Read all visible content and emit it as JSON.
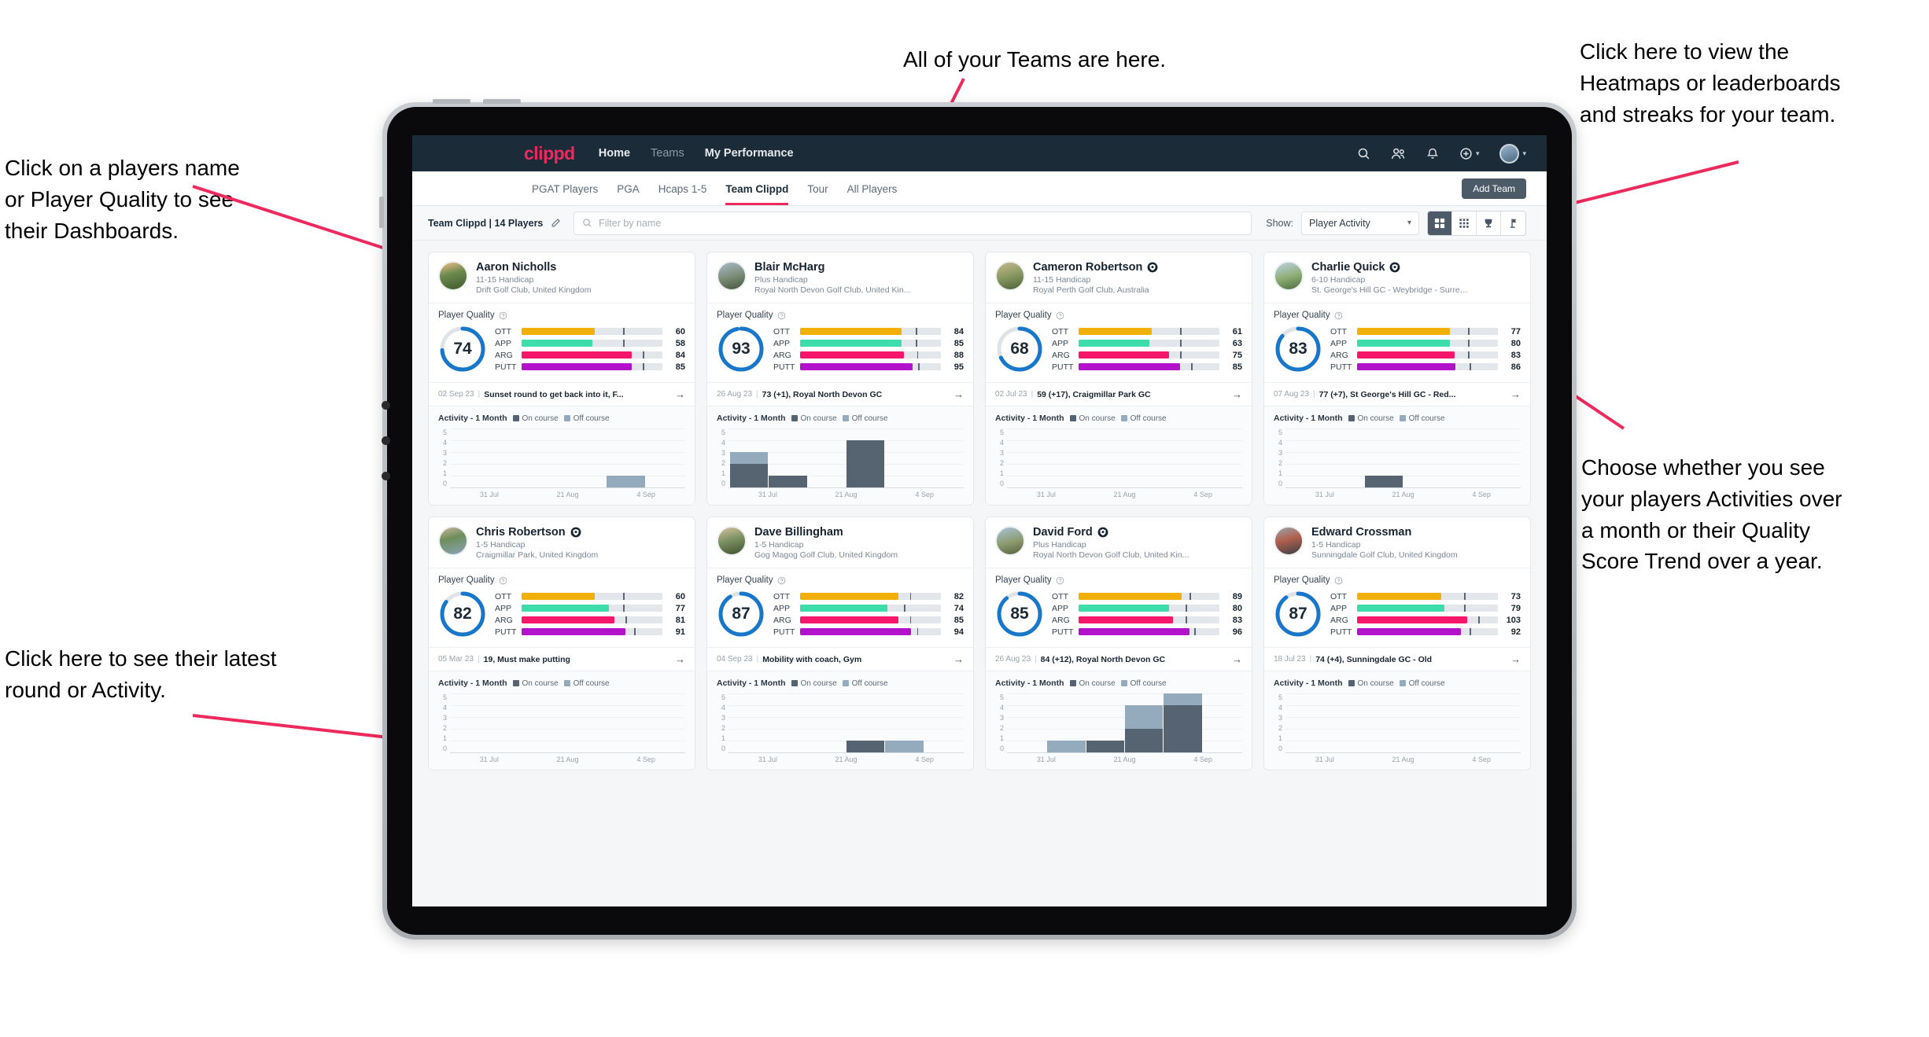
{
  "annotations": [
    {
      "id": "teams-note",
      "text": "All of your Teams are here."
    },
    {
      "id": "heatmaps-note",
      "text": "Click here to view the\nHeatmaps or leaderboards\nand streaks for your team."
    },
    {
      "id": "playername-note",
      "text": "Click on a players name\nor Player Quality to see\ntheir Dashboards."
    },
    {
      "id": "activity-note",
      "text": "Choose whether you see\nyour players Activities over\na month or their Quality\nScore Trend over a year."
    },
    {
      "id": "latest-note",
      "text": "Click here to see their latest\nround or Activity."
    }
  ],
  "topnav": {
    "logo": "clippd",
    "links": [
      {
        "label": "Home",
        "active": true
      },
      {
        "label": "Teams",
        "active": false
      },
      {
        "label": "My Performance",
        "active": true
      }
    ],
    "icons": [
      "search-icon",
      "people-icon",
      "bell-icon",
      "plus-circle-icon",
      "avatar"
    ]
  },
  "subnav": {
    "tabs": [
      {
        "label": "PGAT Players",
        "active": false
      },
      {
        "label": "PGA",
        "active": false
      },
      {
        "label": "Hcaps 1-5",
        "active": false
      },
      {
        "label": "Team Clippd",
        "active": true
      },
      {
        "label": "Tour",
        "active": false
      },
      {
        "label": "All Players",
        "active": false
      }
    ],
    "add_team_label": "Add Team"
  },
  "toolbar": {
    "team_label": "Team Clippd | 14 Players",
    "edit_icon": "pencil-icon",
    "search_placeholder": "Filter by name",
    "search_value": "",
    "show_label": "Show:",
    "show_selected": "Player Activity",
    "view_buttons": [
      {
        "name": "grid-view",
        "icon": "grid-icon",
        "active": true
      },
      {
        "name": "compact-view",
        "icon": "dots-grid-icon",
        "active": false
      },
      {
        "name": "leaderboard-view",
        "icon": "trophy-icon",
        "active": false
      },
      {
        "name": "streaks-view",
        "icon": "flag-icon",
        "active": false
      }
    ]
  },
  "card_labels": {
    "quality_title": "Player Quality",
    "activity_title": "Activity - 1 Month",
    "legend_on": "On course",
    "legend_off": "Off course",
    "metrics": [
      "OTT",
      "APP",
      "ARG",
      "PUTT"
    ],
    "x_ticks": [
      "31 Jul",
      "21 Aug",
      "4 Sep"
    ],
    "y_ticks": [
      "5",
      "4",
      "3",
      "2",
      "1",
      "0"
    ]
  },
  "colors": {
    "accent": "#ec2a5e",
    "navbar": "#1b2b38",
    "ring": "#1877c9",
    "ott": "#f2b007",
    "app": "#3ddcab",
    "arg": "#f4176a",
    "putt": "#b312cb",
    "on_course": "#566471",
    "off_course": "#94aabd"
  },
  "chart_data": {
    "type": "bar",
    "title": "Activity - 1 Month",
    "categories": [
      "31 Jul",
      "21 Aug",
      "4 Sep"
    ],
    "ylim": [
      0,
      5
    ],
    "ylabel": "",
    "xlabel": "",
    "grid": true,
    "legend": [
      "On course",
      "Off course"
    ],
    "stacked": true
  },
  "players": [
    {
      "name": "Aaron Nicholls",
      "verified": false,
      "avatar": "av1",
      "handicap": "11-15 Handicap",
      "club": "Drift Golf Club, United Kingdom",
      "quality": 74,
      "ring_pct": 74,
      "metrics": [
        {
          "label": "OTT",
          "value": 60,
          "fill": 52,
          "tick": 72
        },
        {
          "label": "APP",
          "value": 58,
          "fill": 50,
          "tick": 72
        },
        {
          "label": "ARG",
          "value": 84,
          "fill": 78,
          "tick": 86
        },
        {
          "label": "PUTT",
          "value": 85,
          "fill": 78,
          "tick": 86
        }
      ],
      "round_date": "02 Sep 23",
      "round_text": "Sunset round to get back into it, F...",
      "activity": [
        {
          "on": 0,
          "off": 0
        },
        {
          "on": 0,
          "off": 0
        },
        {
          "on": 0,
          "off": 0
        },
        {
          "on": 0,
          "off": 0
        },
        {
          "on": 0,
          "off": 1
        },
        {
          "on": 0,
          "off": 0
        }
      ]
    },
    {
      "name": "Blair McHarg",
      "verified": false,
      "avatar": "av2",
      "handicap": "Plus Handicap",
      "club": "Royal North Devon Golf Club, United Kin...",
      "quality": 93,
      "ring_pct": 97,
      "metrics": [
        {
          "label": "OTT",
          "value": 84,
          "fill": 72,
          "tick": 82
        },
        {
          "label": "APP",
          "value": 85,
          "fill": 72,
          "tick": 82
        },
        {
          "label": "ARG",
          "value": 88,
          "fill": 74,
          "tick": 83
        },
        {
          "label": "PUTT",
          "value": 95,
          "fill": 80,
          "tick": 84
        }
      ],
      "round_date": "26 Aug 23",
      "round_text": "73 (+1), Royal North Devon GC",
      "activity": [
        {
          "on": 2,
          "off": 1
        },
        {
          "on": 1,
          "off": 0
        },
        {
          "on": 0,
          "off": 0
        },
        {
          "on": 4,
          "off": 0
        },
        {
          "on": 0,
          "off": 0
        },
        {
          "on": 0,
          "off": 0
        }
      ]
    },
    {
      "name": "Cameron Robertson",
      "verified": true,
      "avatar": "av3",
      "handicap": "11-15 Handicap",
      "club": "Royal Perth Golf Club, Australia",
      "quality": 68,
      "ring_pct": 68,
      "metrics": [
        {
          "label": "OTT",
          "value": 61,
          "fill": 52,
          "tick": 72
        },
        {
          "label": "APP",
          "value": 63,
          "fill": 50,
          "tick": 72
        },
        {
          "label": "ARG",
          "value": 75,
          "fill": 64,
          "tick": 72
        },
        {
          "label": "PUTT",
          "value": 85,
          "fill": 72,
          "tick": 80
        }
      ],
      "round_date": "02 Jul 23",
      "round_text": "59 (+17), Craigmillar Park GC",
      "activity": [
        {
          "on": 0,
          "off": 0
        },
        {
          "on": 0,
          "off": 0
        },
        {
          "on": 0,
          "off": 0
        },
        {
          "on": 0,
          "off": 0
        },
        {
          "on": 0,
          "off": 0
        },
        {
          "on": 0,
          "off": 0
        }
      ]
    },
    {
      "name": "Charlie Quick",
      "verified": true,
      "avatar": "av4",
      "handicap": "6-10 Handicap",
      "club": "St. George's Hill GC - Weybridge - Surrey, ...",
      "quality": 83,
      "ring_pct": 86,
      "metrics": [
        {
          "label": "OTT",
          "value": 77,
          "fill": 66,
          "tick": 79
        },
        {
          "label": "APP",
          "value": 80,
          "fill": 66,
          "tick": 79
        },
        {
          "label": "ARG",
          "value": 83,
          "fill": 69,
          "tick": 79
        },
        {
          "label": "PUTT",
          "value": 86,
          "fill": 70,
          "tick": 80
        }
      ],
      "round_date": "07 Aug 23",
      "round_text": "77 (+7), St George's Hill GC - Red...",
      "activity": [
        {
          "on": 0,
          "off": 0
        },
        {
          "on": 0,
          "off": 0
        },
        {
          "on": 1,
          "off": 0
        },
        {
          "on": 0,
          "off": 0
        },
        {
          "on": 0,
          "off": 0
        },
        {
          "on": 0,
          "off": 0
        }
      ]
    },
    {
      "name": "Chris Robertson",
      "verified": true,
      "avatar": "av5",
      "handicap": "1-5 Handicap",
      "club": "Craigmillar Park, United Kingdom",
      "quality": 82,
      "ring_pct": 85,
      "metrics": [
        {
          "label": "OTT",
          "value": 60,
          "fill": 52,
          "tick": 72
        },
        {
          "label": "APP",
          "value": 77,
          "fill": 62,
          "tick": 72
        },
        {
          "label": "ARG",
          "value": 81,
          "fill": 66,
          "tick": 74
        },
        {
          "label": "PUTT",
          "value": 91,
          "fill": 74,
          "tick": 80
        }
      ],
      "round_date": "05 Mar 23",
      "round_text": "19, Must make putting",
      "activity": [
        {
          "on": 0,
          "off": 0
        },
        {
          "on": 0,
          "off": 0
        },
        {
          "on": 0,
          "off": 0
        },
        {
          "on": 0,
          "off": 0
        },
        {
          "on": 0,
          "off": 0
        },
        {
          "on": 0,
          "off": 0
        }
      ]
    },
    {
      "name": "Dave Billingham",
      "verified": false,
      "avatar": "av6",
      "handicap": "1-5 Handicap",
      "club": "Gog Magog Golf Club, United Kingdom",
      "quality": 87,
      "ring_pct": 91,
      "metrics": [
        {
          "label": "OTT",
          "value": 82,
          "fill": 70,
          "tick": 78
        },
        {
          "label": "APP",
          "value": 74,
          "fill": 62,
          "tick": 74
        },
        {
          "label": "ARG",
          "value": 85,
          "fill": 70,
          "tick": 78
        },
        {
          "label": "PUTT",
          "value": 94,
          "fill": 79,
          "tick": 83
        }
      ],
      "round_date": "04 Sep 23",
      "round_text": "Mobility with coach, Gym",
      "activity": [
        {
          "on": 0,
          "off": 0
        },
        {
          "on": 0,
          "off": 0
        },
        {
          "on": 0,
          "off": 0
        },
        {
          "on": 1,
          "off": 0
        },
        {
          "on": 0,
          "off": 1
        },
        {
          "on": 0,
          "off": 0
        }
      ]
    },
    {
      "name": "David Ford",
      "verified": true,
      "avatar": "av7",
      "handicap": "Plus Handicap",
      "club": "Royal North Devon Golf Club, United Kin...",
      "quality": 85,
      "ring_pct": 89,
      "metrics": [
        {
          "label": "OTT",
          "value": 89,
          "fill": 73,
          "tick": 79
        },
        {
          "label": "APP",
          "value": 80,
          "fill": 64,
          "tick": 76
        },
        {
          "label": "ARG",
          "value": 83,
          "fill": 67,
          "tick": 76
        },
        {
          "label": "PUTT",
          "value": 96,
          "fill": 79,
          "tick": 82
        }
      ],
      "round_date": "26 Aug 23",
      "round_text": "84 (+12), Royal North Devon GC",
      "activity": [
        {
          "on": 0,
          "off": 0
        },
        {
          "on": 0,
          "off": 1
        },
        {
          "on": 1,
          "off": 0
        },
        {
          "on": 2,
          "off": 2
        },
        {
          "on": 4,
          "off": 1
        },
        {
          "on": 0,
          "off": 0
        }
      ]
    },
    {
      "name": "Edward Crossman",
      "verified": false,
      "avatar": "av8",
      "handicap": "1-5 Handicap",
      "club": "Sunningdale Golf Club, United Kingdom",
      "quality": 87,
      "ring_pct": 90,
      "metrics": [
        {
          "label": "OTT",
          "value": 73,
          "fill": 60,
          "tick": 76
        },
        {
          "label": "APP",
          "value": 79,
          "fill": 62,
          "tick": 76
        },
        {
          "label": "ARG",
          "value": 103,
          "fill": 78,
          "tick": 86
        },
        {
          "label": "PUTT",
          "value": 92,
          "fill": 74,
          "tick": 80
        }
      ],
      "round_date": "18 Jul 23",
      "round_text": "74 (+4), Sunningdale GC - Old",
      "activity": [
        {
          "on": 0,
          "off": 0
        },
        {
          "on": 0,
          "off": 0
        },
        {
          "on": 0,
          "off": 0
        },
        {
          "on": 0,
          "off": 0
        },
        {
          "on": 0,
          "off": 0
        },
        {
          "on": 0,
          "off": 0
        }
      ]
    }
  ]
}
